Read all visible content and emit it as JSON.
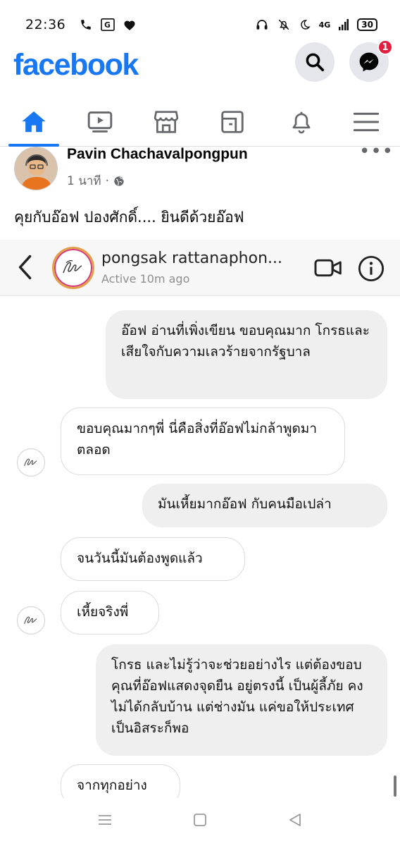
{
  "status_bar": {
    "time": "22:36",
    "left_icons": [
      "phone-icon",
      "translate-icon",
      "heart-icon"
    ],
    "right_icons": [
      "headset-icon",
      "mute-icon",
      "moon-icon",
      "signal-icon"
    ],
    "network": "4G",
    "battery": "30"
  },
  "header": {
    "logo": "facebook",
    "messenger_badge": "1"
  },
  "nav": {
    "tabs": [
      "home",
      "watch",
      "marketplace",
      "pages",
      "notifications",
      "menu"
    ],
    "active": "home"
  },
  "post": {
    "author": "Pavin Chachavalpongpun",
    "time": "1 นาที",
    "separator": "·",
    "text": "คุยกับอ๊อฟ ปองศักดิ์.... ยินดีด้วยอ๊อฟ"
  },
  "chat": {
    "name": "pongsak rattanaphon...",
    "status": "Active 10m ago",
    "messages": [
      {
        "from": "me",
        "text": "อ๊อฟ อ่านที่เพิ่งเขียน ขอบคุณมาก โกรธและเสียใจกับความเลวร้ายจากรัฐบาล"
      },
      {
        "from": "them",
        "text": "ขอบคุณมากๆพี่ นี่คือสิ่งที่อ๊อฟไม่กล้าพูดมาตลอด"
      },
      {
        "from": "me",
        "text": "มันเหี้ยมากอ๊อฟ กับคนมือเปล่า"
      },
      {
        "from": "them",
        "text": "จนวันนี้มันต้องพูดแล้ว"
      },
      {
        "from": "them",
        "text": "เหี้ยจริงพี่"
      },
      {
        "from": "me",
        "text": "โกรธ และไม่รู้ว่าจะช่วยอย่างไร แต่ต้องขอบคุณที่อ๊อฟแสดงจุดยืน อยู่ตรงนี้ เป็นผู้ลี้ภัย คงไม่ได้กลับบ้าน แต่ช่างมัน แค่ขอให้ประเทศเป็นอิสระก็พอ"
      },
      {
        "from": "them",
        "text": "จากทุกอย่าง"
      }
    ]
  },
  "colors": {
    "brand": "#1877f2",
    "badge": "#e41e3f",
    "muted": "#65676b"
  }
}
